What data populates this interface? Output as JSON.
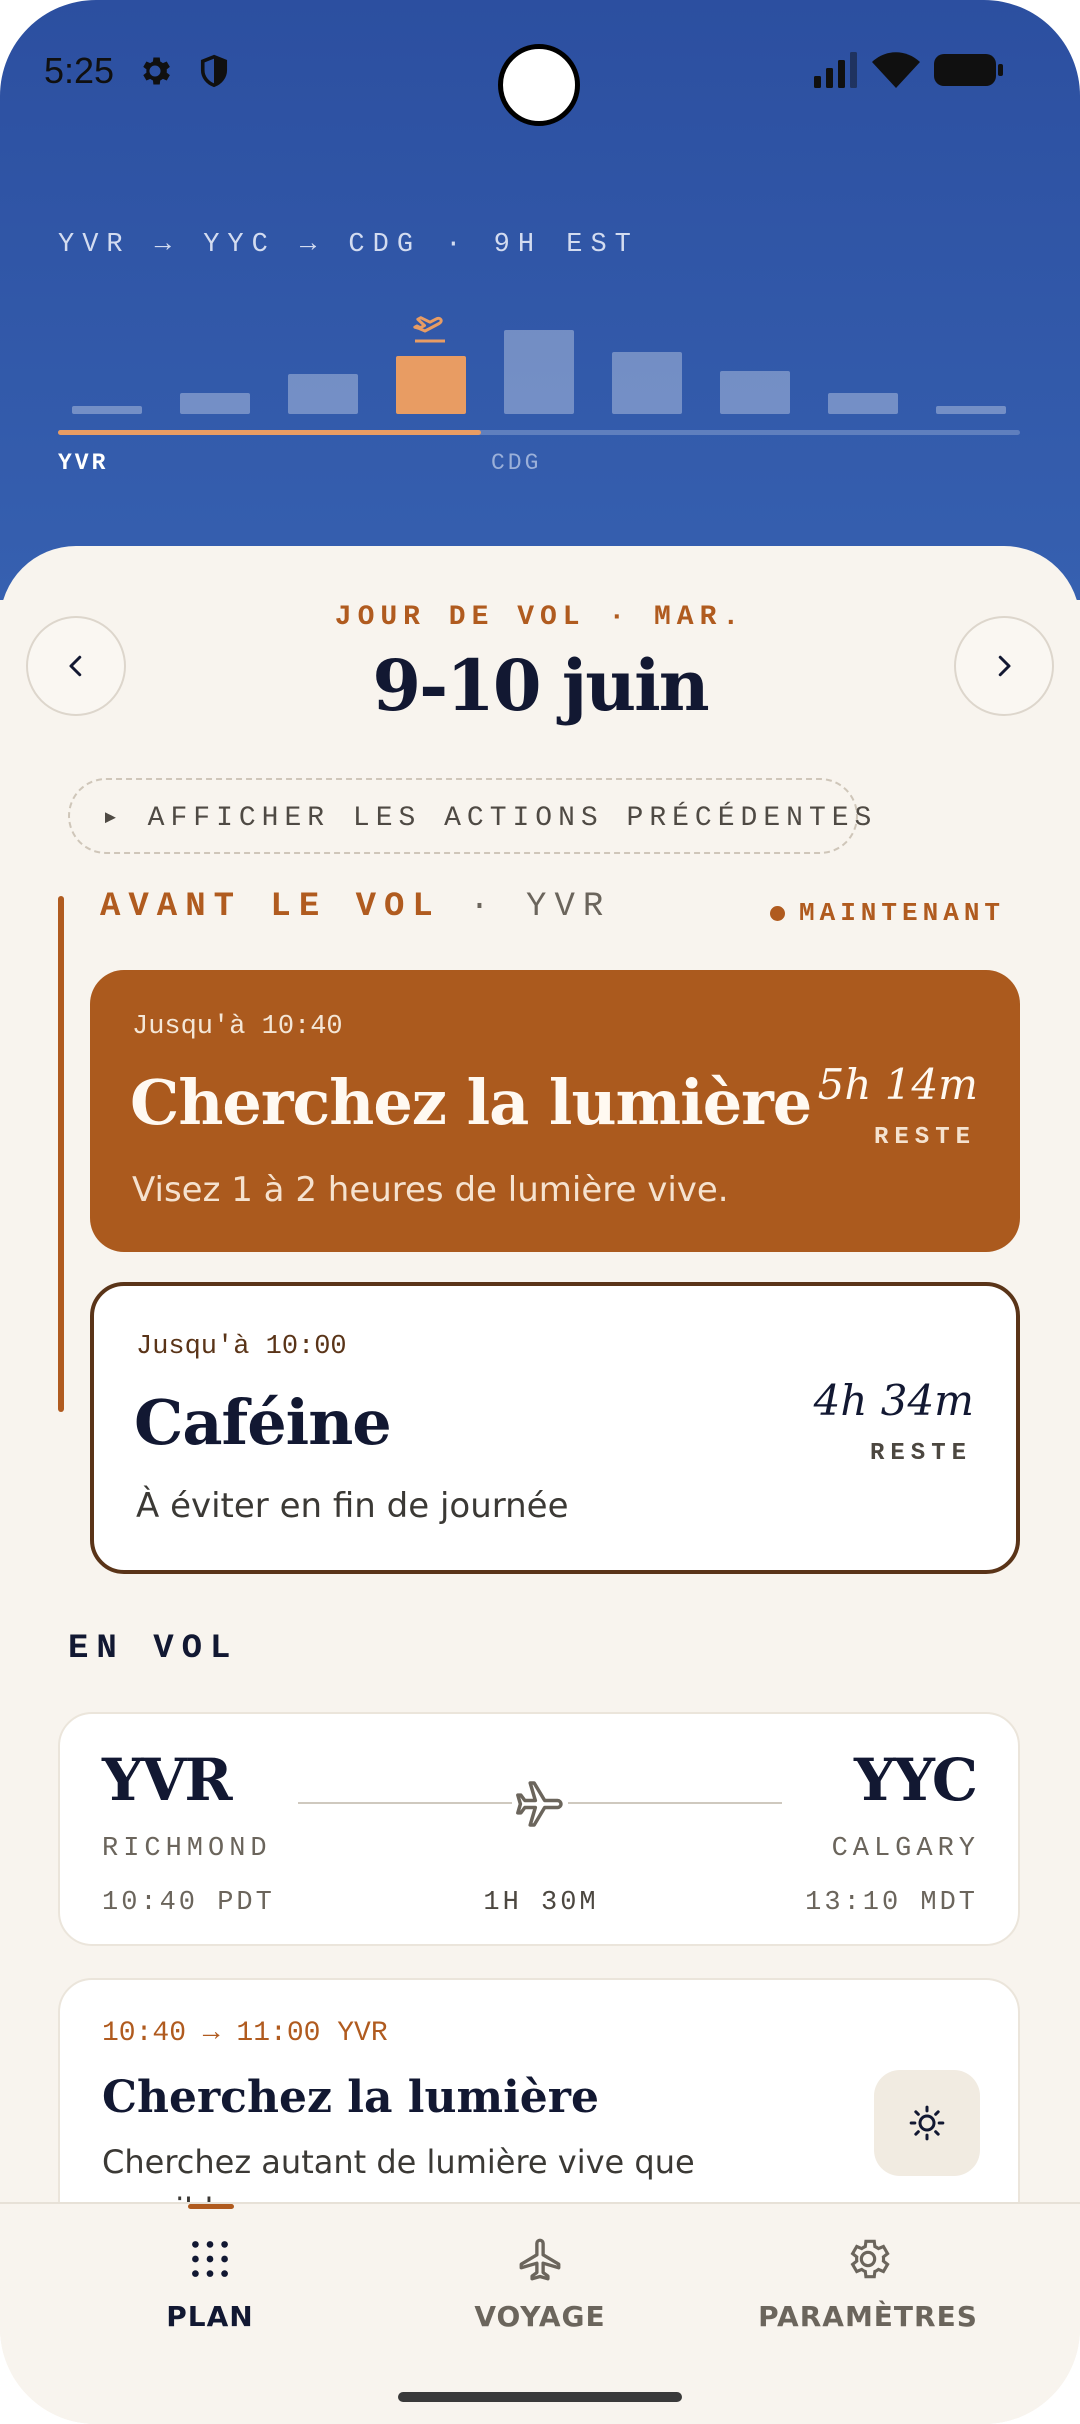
{
  "status_bar": {
    "time": "5:25"
  },
  "header": {
    "route": "YVR → YYC → CDG · 9H EST",
    "axis_start": "YVR",
    "axis_end": "CDG",
    "progress_fraction": 0.44,
    "bar_levels": [
      0.08,
      0.22,
      0.42,
      0.6,
      0.88,
      0.65,
      0.45,
      0.22,
      0.08
    ],
    "active_bar_index": 3,
    "accent_color": "#e89c63",
    "background_color": "#2c4fa0"
  },
  "day": {
    "kicker": "JOUR DE VOL · MAR.",
    "title": "9-10 juin",
    "show_previous": "▸ AFFICHER LES ACTIONS PRÉCÉDENTES"
  },
  "before_flight": {
    "label": "AVANT LE VOL",
    "airport": "· YVR",
    "now_label": "MAINTENANT",
    "cards": [
      {
        "until": "Jusqu'à 10:40",
        "title": "Cherchez la lumière",
        "subtitle": "Visez 1 à 2 heures de lumière vive.",
        "remaining": "5h 14m",
        "remaining_label": "RESTE"
      },
      {
        "until": "Jusqu'à 10:00",
        "title": "Caféine",
        "subtitle": "À éviter en fin de journée",
        "remaining": "4h 34m",
        "remaining_label": "RESTE"
      }
    ]
  },
  "in_flight": {
    "label": "EN VOL",
    "flight": {
      "from_code": "YVR",
      "from_city": "RICHMOND",
      "from_time": "10:40 PDT",
      "to_code": "YYC",
      "to_city": "CALGARY",
      "to_time": "13:10 MDT",
      "duration": "1H 30M"
    },
    "recommendation": {
      "time": "10:40 → 11:00 YVR",
      "title": "Cherchez la lumière",
      "subtitle": "Cherchez autant de lumière vive que possible."
    }
  },
  "bottom_nav": {
    "tabs": [
      {
        "label": "PLAN",
        "icon": "grid-dots-icon",
        "active": true
      },
      {
        "label": "VOYAGE",
        "icon": "airplane-icon",
        "active": false
      },
      {
        "label": "PARAMÈTRES",
        "icon": "gear-icon",
        "active": false
      }
    ]
  },
  "colors": {
    "primary_brown": "#b05b1f",
    "ink": "#121832",
    "sheet_background": "#f8f4ee"
  }
}
